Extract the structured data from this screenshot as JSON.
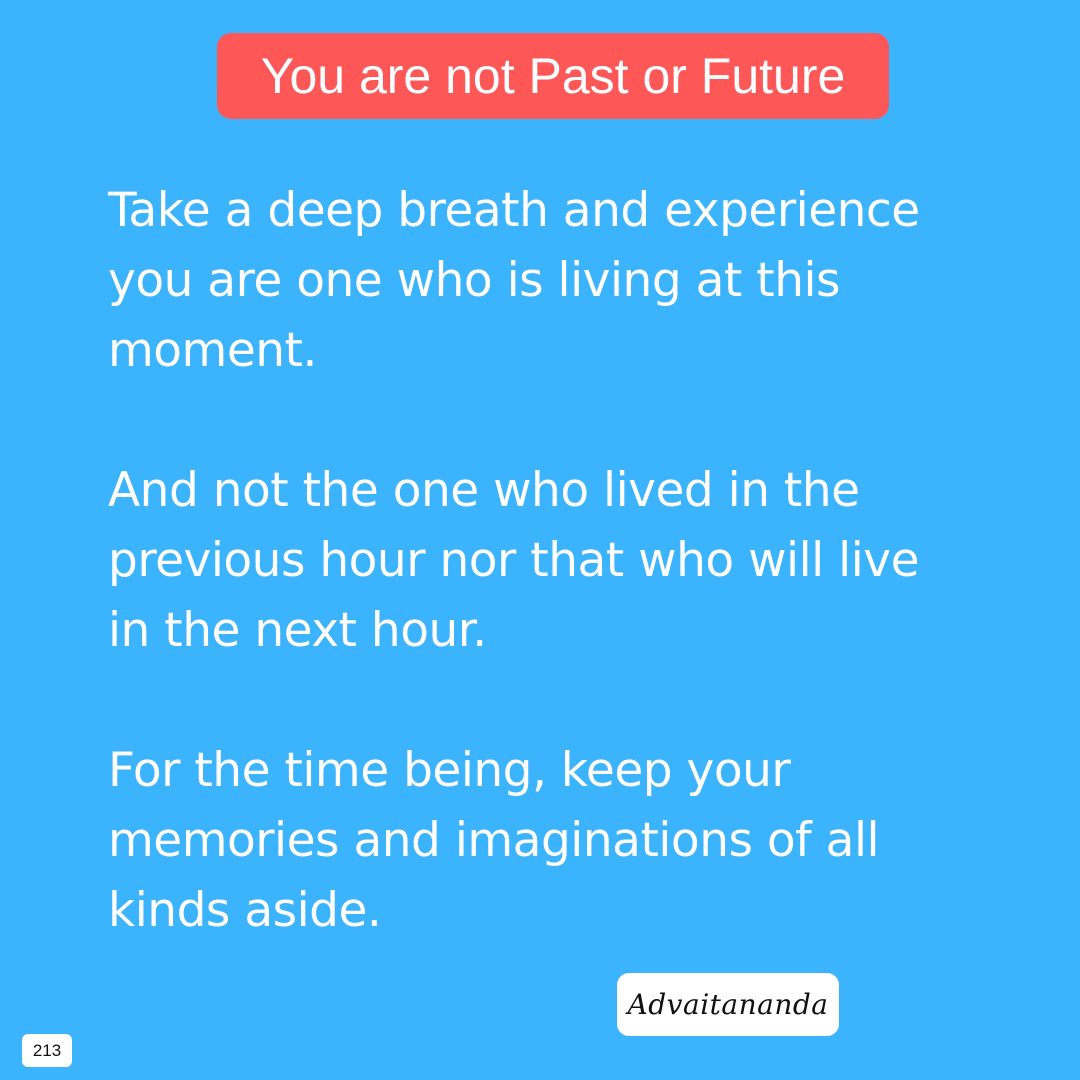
{
  "title": "You are not Past or Future",
  "paragraphs": [
    {
      "lines": [
        "Take a deep breath and experience",
        "you are one who is living at this",
        "moment."
      ]
    },
    {
      "lines": [
        "And not the one who lived in the",
        "previous hour nor that who will live",
        "in the next hour."
      ]
    },
    {
      "lines": [
        "For the time being, keep your",
        "memories and imaginations of all",
        "kinds aside."
      ]
    }
  ],
  "signature": "Advaitananda",
  "page_number": "213",
  "colors": {
    "background": "#3bb3fd",
    "title_background": "#fe5757",
    "text": "#ffffff",
    "badge_background": "#ffffff"
  }
}
